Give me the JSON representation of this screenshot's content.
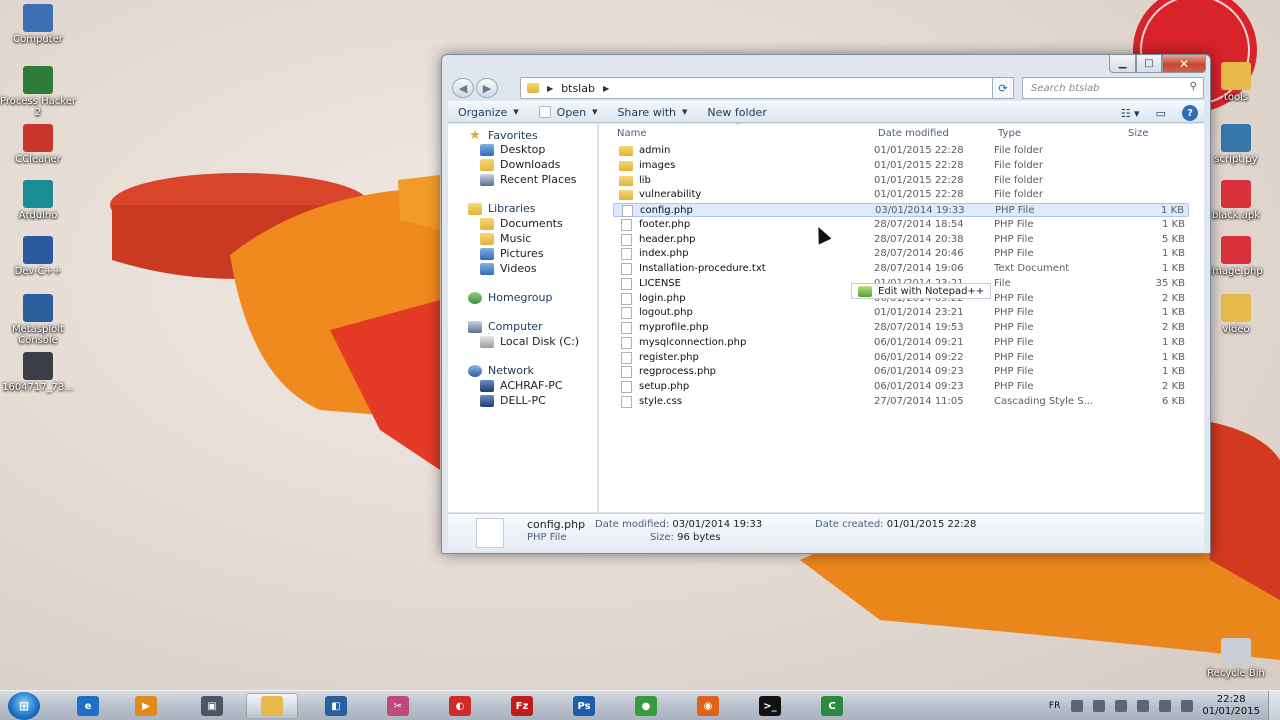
{
  "desktop": {
    "left_icons": [
      {
        "label": "Computer",
        "icon": "computer-icon",
        "color": "#3c6fb3"
      },
      {
        "label": "Process Hacker 2",
        "icon": "process-hacker-icon",
        "color": "#2f7d3a"
      },
      {
        "label": "CCleaner",
        "icon": "ccleaner-icon",
        "color": "#c9352b"
      },
      {
        "label": "Arduino",
        "icon": "arduino-icon",
        "color": "#1b8c95"
      },
      {
        "label": "Dev-C++",
        "icon": "devcpp-icon",
        "color": "#2c5aa0"
      },
      {
        "label": "Metasploit Console",
        "icon": "metasploit-icon",
        "color": "#2a5f9e"
      },
      {
        "label": "1604717_73...",
        "icon": "image-file-icon",
        "color": "#3a3f47"
      }
    ],
    "right_icons": [
      {
        "label": "tools",
        "icon": "folder-icon",
        "color": "#e6b94a"
      },
      {
        "label": "script.py",
        "icon": "python-file-icon",
        "color": "#3776ab"
      },
      {
        "label": "black.apk",
        "icon": "apk-file-icon",
        "color": "#d9323a"
      },
      {
        "label": "image.php",
        "icon": "php-file-icon",
        "color": "#d9323a"
      },
      {
        "label": "video",
        "icon": "folder-icon",
        "color": "#e6b94a"
      },
      {
        "label": "Recycle Bin",
        "icon": "recycle-bin-icon",
        "color": "#c9ced6"
      }
    ]
  },
  "explorer": {
    "breadcrumb": "btslab",
    "search_placeholder": "Search btslab",
    "toolbar": {
      "organize": "Organize",
      "open": "Open",
      "share_with": "Share with",
      "new_folder": "New folder"
    },
    "nav": {
      "favorites": "Favorites",
      "desktop": "Desktop",
      "downloads": "Downloads",
      "recent_places": "Recent Places",
      "libraries": "Libraries",
      "documents": "Documents",
      "music": "Music",
      "pictures": "Pictures",
      "videos": "Videos",
      "homegroup": "Homegroup",
      "computer": "Computer",
      "local_disk": "Local Disk (C:)",
      "network": "Network",
      "pc1": "ACHRAF-PC",
      "pc2": "DELL-PC"
    },
    "columns": {
      "name": "Name",
      "date_modified": "Date modified",
      "type": "Type",
      "size": "Size"
    },
    "files": [
      {
        "name": "admin",
        "date": "01/01/2015 22:28",
        "type": "File folder",
        "size": "",
        "kind": "folder"
      },
      {
        "name": "images",
        "date": "01/01/2015 22:28",
        "type": "File folder",
        "size": "",
        "kind": "folder"
      },
      {
        "name": "lib",
        "date": "01/01/2015 22:28",
        "type": "File folder",
        "size": "",
        "kind": "folder"
      },
      {
        "name": "vulnerability",
        "date": "01/01/2015 22:28",
        "type": "File folder",
        "size": "",
        "kind": "folder"
      },
      {
        "name": "config.php",
        "date": "03/01/2014 19:33",
        "type": "PHP File",
        "size": "1 KB",
        "kind": "doc"
      },
      {
        "name": "footer.php",
        "date": "28/07/2014 18:54",
        "type": "PHP File",
        "size": "1 KB",
        "kind": "doc"
      },
      {
        "name": "header.php",
        "date": "28/07/2014 20:38",
        "type": "PHP File",
        "size": "5 KB",
        "kind": "doc"
      },
      {
        "name": "index.php",
        "date": "28/07/2014 20:46",
        "type": "PHP File",
        "size": "1 KB",
        "kind": "doc"
      },
      {
        "name": "Installation-procedure.txt",
        "date": "28/07/2014 19:06",
        "type": "Text Document",
        "size": "1 KB",
        "kind": "doc"
      },
      {
        "name": "LICENSE",
        "date": "01/01/2014 23:21",
        "type": "File",
        "size": "35 KB",
        "kind": "doc"
      },
      {
        "name": "login.php",
        "date": "06/01/2014 09:22",
        "type": "PHP File",
        "size": "2 KB",
        "kind": "doc"
      },
      {
        "name": "logout.php",
        "date": "01/01/2014 23:21",
        "type": "PHP File",
        "size": "1 KB",
        "kind": "doc"
      },
      {
        "name": "myprofile.php",
        "date": "28/07/2014 19:53",
        "type": "PHP File",
        "size": "2 KB",
        "kind": "doc"
      },
      {
        "name": "mysqlconnection.php",
        "date": "06/01/2014 09:21",
        "type": "PHP File",
        "size": "1 KB",
        "kind": "doc"
      },
      {
        "name": "register.php",
        "date": "06/01/2014 09:22",
        "type": "PHP File",
        "size": "1 KB",
        "kind": "doc"
      },
      {
        "name": "regprocess.php",
        "date": "06/01/2014 09:23",
        "type": "PHP File",
        "size": "1 KB",
        "kind": "doc"
      },
      {
        "name": "setup.php",
        "date": "06/01/2014 09:23",
        "type": "PHP File",
        "size": "2 KB",
        "kind": "doc"
      },
      {
        "name": "style.css",
        "date": "27/07/2014 11:05",
        "type": "Cascading Style S...",
        "size": "6 KB",
        "kind": "doc"
      }
    ],
    "drag_tooltip": "Edit with Notepad++",
    "details": {
      "name": "config.php",
      "type": "PHP File",
      "date_modified_label": "Date modified:",
      "date_modified": "03/01/2014 19:33",
      "size_label": "Size:",
      "size": "96 bytes",
      "date_created_label": "Date created:",
      "date_created": "01/01/2015 22:28"
    }
  },
  "taskbar": {
    "apps": [
      {
        "icon": "internet-explorer-icon",
        "color": "#1f6fc7",
        "active": false
      },
      {
        "icon": "media-player-icon",
        "color": "#e08a1a",
        "active": false
      },
      {
        "icon": "window-app-icon",
        "color": "#4a5566",
        "active": false
      },
      {
        "icon": "file-explorer-icon",
        "color": "#e6b94a",
        "active": true
      },
      {
        "icon": "network-tool-icon",
        "color": "#2a5f9e",
        "active": false
      },
      {
        "icon": "sniffer-icon",
        "color": "#c0487a",
        "active": false
      },
      {
        "icon": "virtual-machine-icon",
        "color": "#d12a2a",
        "active": false
      },
      {
        "icon": "filezilla-icon",
        "color": "#bf1d1d",
        "active": false
      },
      {
        "icon": "photoshop-icon",
        "color": "#1d5ea8",
        "active": false
      },
      {
        "icon": "chrome-icon",
        "color": "#3a9a3f",
        "active": false
      },
      {
        "icon": "firefox-icon",
        "color": "#e0621a",
        "active": false
      },
      {
        "icon": "terminal-icon",
        "color": "#111111",
        "active": false
      },
      {
        "icon": "camtasia-icon",
        "color": "#2c8a3e",
        "active": false
      }
    ],
    "app_glyphs": [
      "e",
      "▶",
      "▣",
      "",
      "◧",
      "✂",
      "◐",
      "Fz",
      "Ps",
      "●",
      "◉",
      ">_",
      "C"
    ],
    "lang": "FR",
    "time": "22:28",
    "date": "01/01/2015"
  }
}
